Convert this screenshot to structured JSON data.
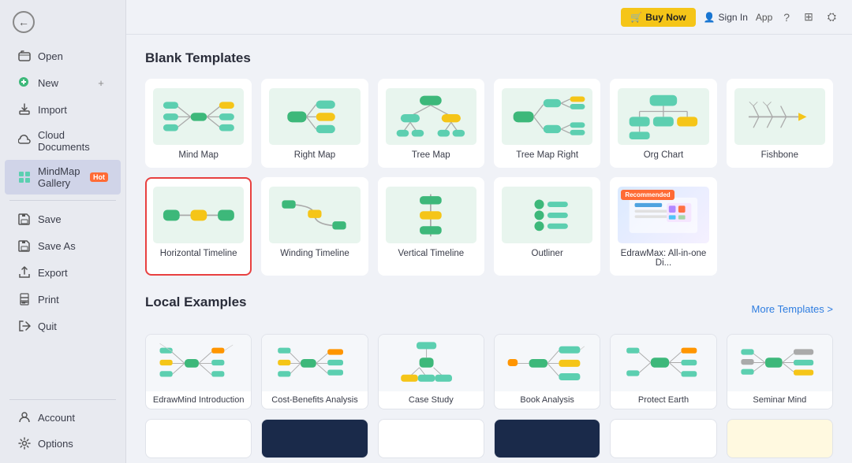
{
  "topbar": {
    "buy_now": "Buy Now",
    "sign_in": "Sign In",
    "app_label": "App"
  },
  "sidebar": {
    "items": [
      {
        "id": "open",
        "label": "Open",
        "icon": "📂"
      },
      {
        "id": "new",
        "label": "New",
        "icon": "🟢"
      },
      {
        "id": "import",
        "label": "Import",
        "icon": "📥"
      },
      {
        "id": "cloud",
        "label": "Cloud Documents",
        "icon": "☁️"
      },
      {
        "id": "gallery",
        "label": "MindMap Gallery",
        "icon": "🖼️",
        "badge": "Hot"
      },
      {
        "id": "save",
        "label": "Save",
        "icon": "💾"
      },
      {
        "id": "save_as",
        "label": "Save As",
        "icon": "💾"
      },
      {
        "id": "export",
        "label": "Export",
        "icon": "📤"
      },
      {
        "id": "print",
        "label": "Print",
        "icon": "🖨️"
      },
      {
        "id": "quit",
        "label": "Quit",
        "icon": "✖️"
      }
    ],
    "bottom_items": [
      {
        "id": "account",
        "label": "Account",
        "icon": "👤"
      },
      {
        "id": "options",
        "label": "Options",
        "icon": "⚙️"
      }
    ]
  },
  "blank_templates": {
    "title": "Blank Templates",
    "items": [
      {
        "id": "mind-map",
        "label": "Mind Map",
        "type": "mindmap"
      },
      {
        "id": "right-map",
        "label": "Right Map",
        "type": "rightmap"
      },
      {
        "id": "tree-map",
        "label": "Tree Map",
        "type": "treemap"
      },
      {
        "id": "tree-map-right",
        "label": "Tree Map Right",
        "type": "treemapright"
      },
      {
        "id": "org-chart",
        "label": "Org Chart",
        "type": "orgchart"
      },
      {
        "id": "fishbone",
        "label": "Fishbone",
        "type": "fishbone"
      },
      {
        "id": "horizontal-timeline",
        "label": "Horizontal Timeline",
        "type": "htimeline",
        "selected": true
      },
      {
        "id": "winding-timeline",
        "label": "Winding Timeline",
        "type": "wtimeline"
      },
      {
        "id": "vertical-timeline",
        "label": "Vertical Timeline",
        "type": "vtimeline"
      },
      {
        "id": "outliner",
        "label": "Outliner",
        "type": "outliner"
      },
      {
        "id": "edrawmax",
        "label": "EdrawMax: All-in-one Di...",
        "type": "edrawmax",
        "recommended": true
      }
    ]
  },
  "local_examples": {
    "title": "Local Examples",
    "more_label": "More Templates >",
    "items": [
      {
        "id": "edrawmind-intro",
        "label": "EdrawMind Introduction",
        "type": "intro"
      },
      {
        "id": "cost-benefits",
        "label": "Cost-Benefits Analysis",
        "type": "cost"
      },
      {
        "id": "case-study",
        "label": "Case Study",
        "type": "study"
      },
      {
        "id": "book-analysis",
        "label": "Book Analysis",
        "type": "book"
      },
      {
        "id": "protect-earth",
        "label": "Protect Earth",
        "type": "earth"
      },
      {
        "id": "seminar-mind",
        "label": "Seminar Mind",
        "type": "seminar"
      }
    ]
  },
  "colors": {
    "accent_red": "#e84040",
    "accent_yellow": "#f5c518",
    "accent_teal": "#5ccfb0",
    "accent_green": "#3db87a",
    "bg_card": "#e8f5ee",
    "more_link": "#2e7de0"
  }
}
